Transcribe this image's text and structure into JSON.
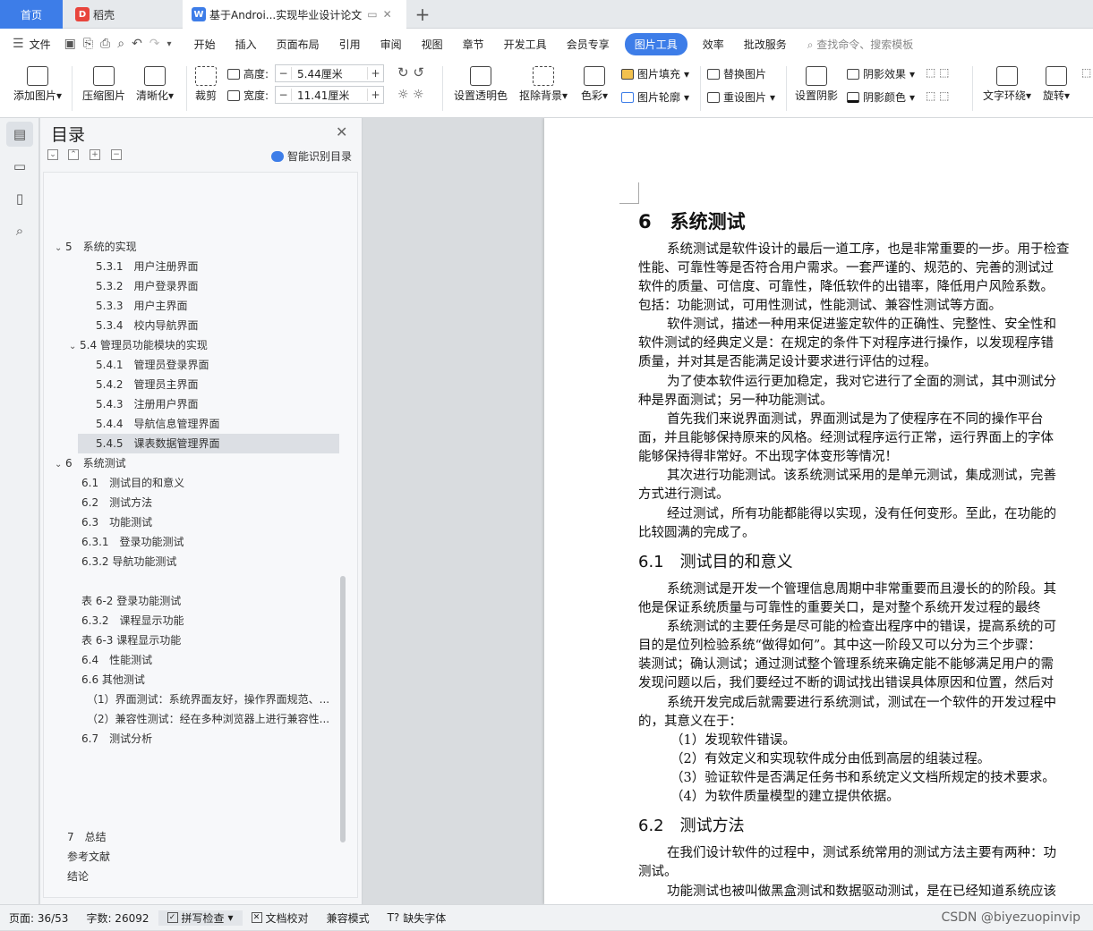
{
  "tabs": {
    "home": "首页",
    "daoke": "稻壳",
    "doc": "基于Androi...实现毕业设计论文"
  },
  "menu": {
    "file": "文件",
    "items": [
      "开始",
      "插入",
      "页面布局",
      "引用",
      "审阅",
      "视图",
      "章节",
      "开发工具",
      "会员专享"
    ],
    "active": "图片工具",
    "after": [
      "效率",
      "批改服务"
    ],
    "search": "查找命令、搜索模板"
  },
  "toolbar": {
    "add_image": "添加图片",
    "compress": "压缩图片",
    "sharpen": "清晰化",
    "crop": "裁剪",
    "height_label": "高度:",
    "height_value": "5.44厘米",
    "width_label": "宽度:",
    "width_value": "11.41厘米",
    "transparent": "设置透明色",
    "remove_bg": "抠除背景",
    "color": "色彩",
    "fill": "图片填充",
    "outline": "图片轮廓",
    "replace": "替换图片",
    "reset": "重设图片",
    "shadow_set": "设置阴影",
    "shadow_effect": "阴影效果",
    "shadow_color": "阴影颜色",
    "text_wrap": "文字环绕",
    "rotate": "旋转"
  },
  "toc": {
    "title": "目录",
    "ai_label": "智能识别目录",
    "items": [
      {
        "text": "5　系统的实现",
        "caret": true
      },
      {
        "text": "5.3.1　用户注册界面"
      },
      {
        "text": "5.3.2　用户登录界面"
      },
      {
        "text": "5.3.3　用户主界面"
      },
      {
        "text": "5.3.4　校内导航界面"
      },
      {
        "text": "5.4 管理员功能模块的实现",
        "caret": true
      },
      {
        "text": "5.4.1　管理员登录界面"
      },
      {
        "text": "5.4.2　管理员主界面"
      },
      {
        "text": "5.4.3　注册用户界面"
      },
      {
        "text": "5.4.4　导航信息管理界面"
      },
      {
        "text": "5.4.5　课表数据管理界面"
      },
      {
        "text": "6　系统测试",
        "caret": true
      },
      {
        "text": "6.1　测试目的和意义"
      },
      {
        "text": "6.2　测试方法"
      },
      {
        "text": "6.3　功能测试"
      },
      {
        "text": "6.3.1　登录功能测试"
      },
      {
        "text": "6.3.2 导航功能测试"
      },
      {
        "text": "表 6-2 登录功能测试"
      },
      {
        "text": "6.3.2　课程显示功能"
      },
      {
        "text": "表 6-3 课程显示功能"
      },
      {
        "text": "6.4　性能测试"
      },
      {
        "text": "6.6 其他测试"
      },
      {
        "text": "（1）界面测试：系统界面友好，操作界面规范、..."
      },
      {
        "text": "（2）兼容性测试：经在多种浏览器上进行兼容性..."
      },
      {
        "text": "6.7　测试分析"
      },
      {
        "text": "7　总结"
      },
      {
        "text": "参考文献"
      },
      {
        "text": "结论"
      }
    ]
  },
  "document": {
    "lines": [
      "6　系统测试",
      "系统测试是软件设计的最后一道工序，也是非常重要的一步。用于检查",
      "性能、可靠性等是否符合用户需求。一套严谨的、规范的、完善的测试过",
      "软件的质量、可信度、可靠性，降低软件的出错率，降低用户风险系数。",
      "包括：功能测试，可用性测试，性能测试、兼容性测试等方面。",
      "软件测试，描述一种用来促进鉴定软件的正确性、完整性、安全性和",
      "软件测试的经典定义是：在规定的条件下对程序进行操作，以发现程序错",
      "质量，并对其是否能满足设计要求进行评估的过程。",
      "为了使本软件运行更加稳定，我对它进行了全面的测试，其中测试分",
      "种是界面测试；另一种功能测试。",
      "首先我们来说界面测试，界面测试是为了使程序在不同的操作平台",
      "面，并且能够保持原来的风格。经测试程序运行正常，运行界面上的字体",
      "能够保持得非常好。不出现字体变形等情况！",
      "其次进行功能测试。该系统测试采用的是单元测试，集成测试，完善",
      "方式进行测试。",
      "经过测试，所有功能都能得以实现，没有任何变形。至此，在功能的",
      "比较圆满的完成了。",
      "6.1　测试目的和意义",
      "系统测试是开发一个管理信息周期中非常重要而且漫长的的阶段。其",
      "他是保证系统质量与可靠性的重要关口，是对整个系统开发过程的最终",
      "系统测试的主要任务是尽可能的检查出程序中的错误，提高系统的可",
      "目的是位列检验系统“做得如何”。其中这一阶段又可以分为三个步骤：",
      "装测试；确认测试；通过测试整个管理系统来确定能不能够满足用户的需",
      "发现问题以后，我们要经过不断的调试找出错误具体原因和位置，然后对",
      "系统开发完成后就需要进行系统测试，测试在一个软件的开发过程中",
      "的，其意义在于：",
      "（1）发现软件错误。",
      "（2）有效定义和实现软件成分由低到高层的组装过程。",
      "（3）验证软件是否满足任务书和系统定义文档所规定的技术要求。",
      "（4）为软件质量模型的建立提供依据。",
      "6.2　测试方法",
      "在我们设计软件的过程中，测试系统常用的测试方法主要有两种：功",
      "测试。",
      "功能测试也被叫做黑盒测试和数据驱动测试，是在已经知道系统应该"
    ]
  },
  "status": {
    "page": "页面: 36/53",
    "words": "字数: 26092",
    "spell": "拼写检查",
    "proof": "文档校对",
    "compat": "兼容模式",
    "font": "缺失字体",
    "watermark": "CSDN @biyezuopinvip"
  },
  "colors": {
    "accent": "#3d7de8",
    "daoke_red": "#e8453c"
  }
}
